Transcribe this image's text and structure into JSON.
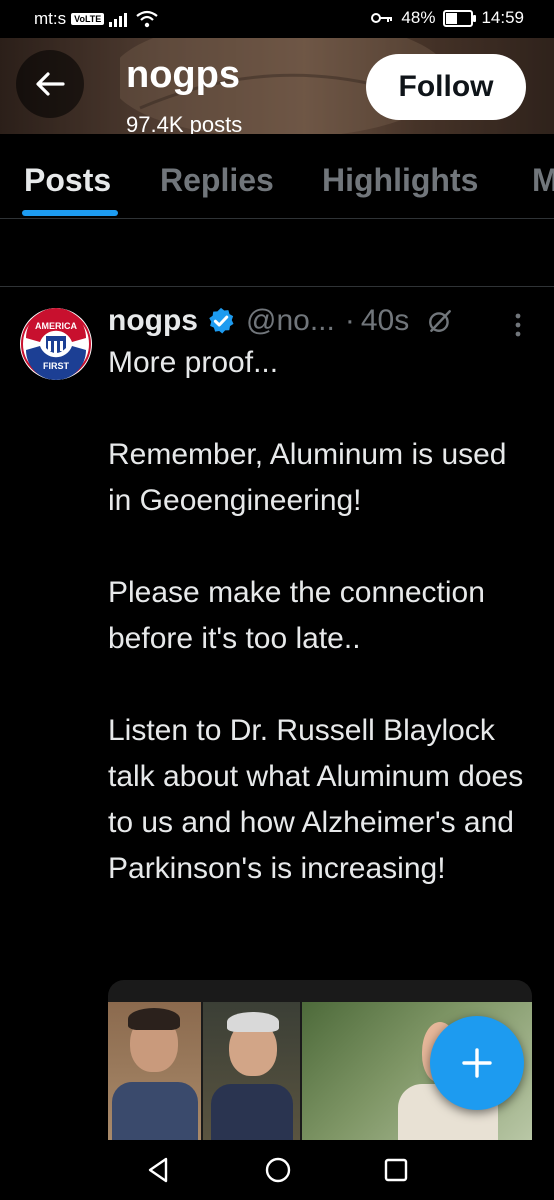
{
  "status_bar": {
    "carrier": "mt:s",
    "volte": "VoLTE",
    "battery": "48%",
    "time": "14:59"
  },
  "header": {
    "name": "nogps",
    "posts_count": "97.4K posts",
    "follow_label": "Follow"
  },
  "tabs": [
    {
      "label": "Posts",
      "active": true
    },
    {
      "label": "Replies",
      "active": false
    },
    {
      "label": "Highlights",
      "active": false
    },
    {
      "label": "M",
      "active": false
    }
  ],
  "tweet": {
    "avatar_text_top": "AMERICA",
    "avatar_text_bottom": "FIRST",
    "name": "nogps",
    "handle": "@no...",
    "dot": "·",
    "time": "40s",
    "text": "More proof...\n\nRemember, Aluminum is used in Geoengineering!\n\nPlease make the connection before it's too late..\n\nListen to Dr. Russell Blaylock talk about what Aluminum does to us and how Alzheimer's and Parkinson's is increasing!"
  },
  "colors": {
    "accent": "#1d9bf0",
    "background": "#000000",
    "text": "#e7e9ea",
    "muted": "#71767b"
  }
}
